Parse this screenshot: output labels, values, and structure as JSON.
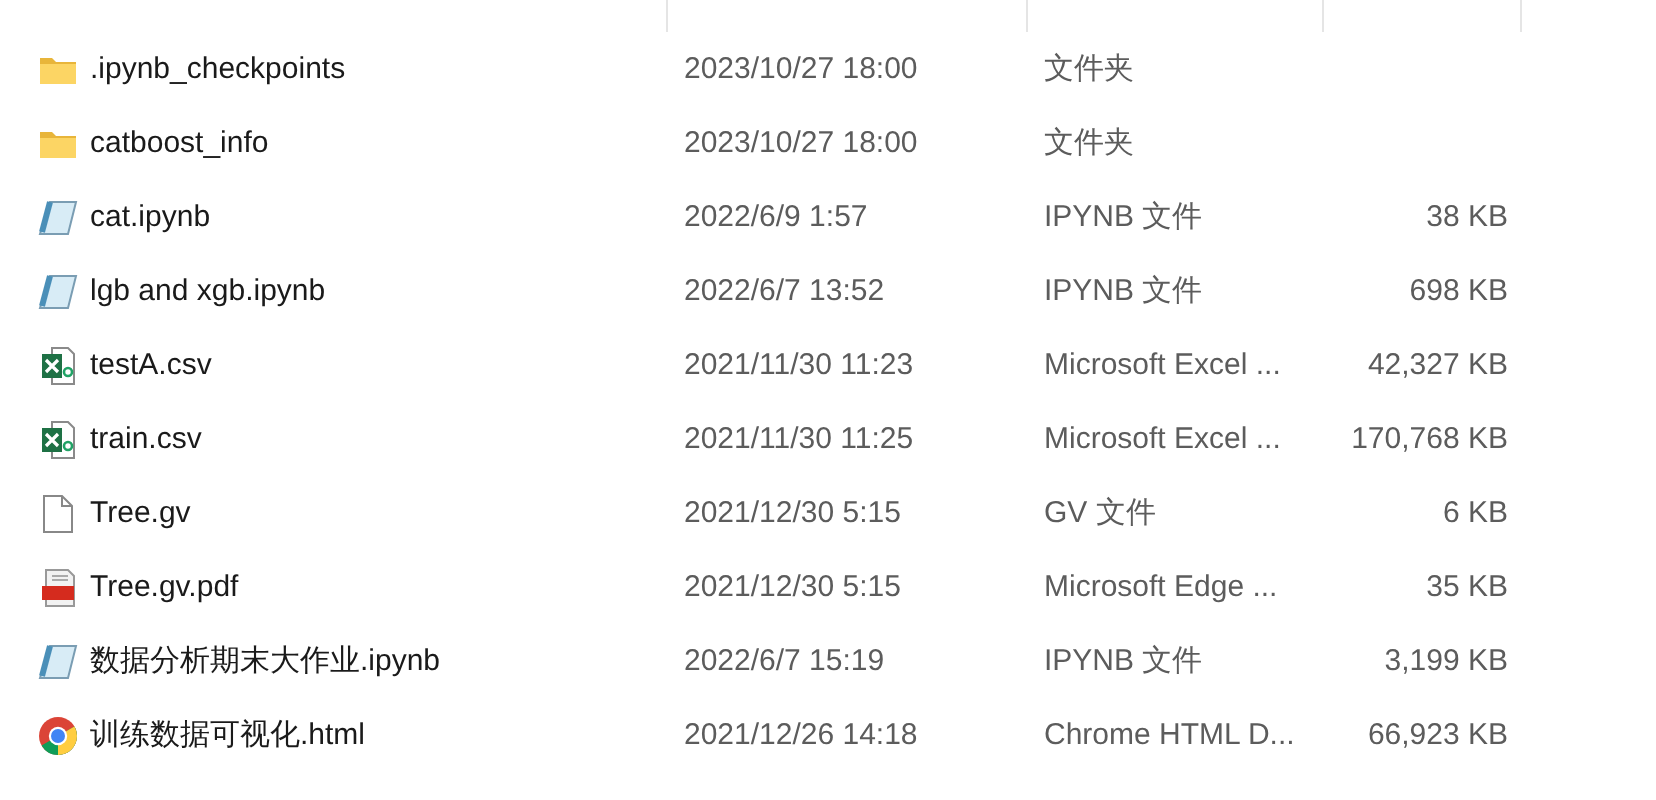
{
  "files": [
    {
      "kind": "folder",
      "name": ".ipynb_checkpoints",
      "modified": "2023/10/27 18:00",
      "type": "文件夹"
    },
    {
      "kind": "folder",
      "name": "catboost_info",
      "modified": "2023/10/27 18:00",
      "type": "文件夹"
    },
    {
      "kind": "notebook",
      "name": "cat.ipynb",
      "modified": "2022/6/9 1:57",
      "type": "IPYNB 文件",
      "size": "38 KB"
    },
    {
      "kind": "notebook",
      "name": "lgb and xgb.ipynb",
      "modified": "2022/6/7 13:52",
      "type": "IPYNB 文件",
      "size": "698 KB"
    },
    {
      "kind": "spreadsheet",
      "name": "testA.csv",
      "modified": "2021/11/30 11:23",
      "type": "Microsoft Excel ...",
      "size": "42,327 KB"
    },
    {
      "kind": "spreadsheet",
      "name": "train.csv",
      "modified": "2021/11/30 11:25",
      "type": "Microsoft Excel ...",
      "size": "170,768 KB"
    },
    {
      "kind": "plain",
      "name": "Tree.gv",
      "modified": "2021/12/30 5:15",
      "type": "GV 文件",
      "size": "6 KB"
    },
    {
      "kind": "pdf",
      "name": "Tree.gv.pdf",
      "modified": "2021/12/30 5:15",
      "type": "Microsoft Edge ...",
      "size": "35 KB"
    },
    {
      "kind": "notebook",
      "name": "数据分析期末大作业.ipynb",
      "modified": "2022/6/7 15:19",
      "type": "IPYNB 文件",
      "size": "3,199 KB"
    },
    {
      "kind": "web",
      "name": "训练数据可视化.html",
      "modified": "2021/12/26 14:18",
      "type": "Chrome HTML D...",
      "size": "66,923 KB"
    }
  ]
}
